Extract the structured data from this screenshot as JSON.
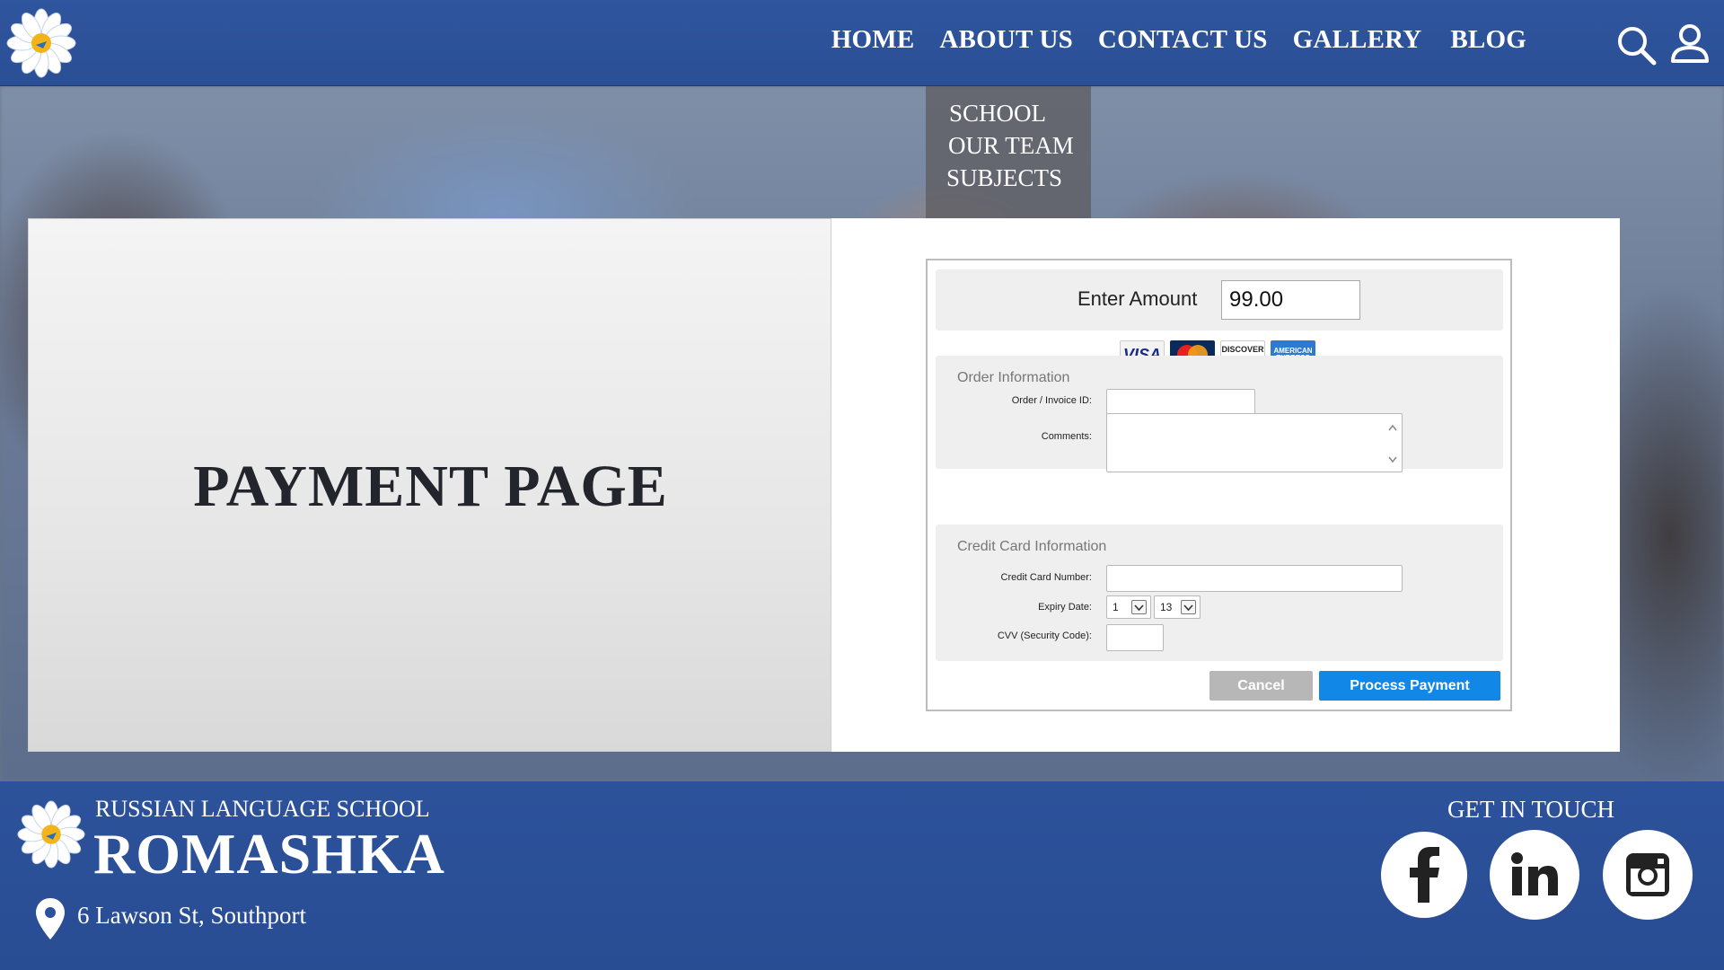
{
  "header": {
    "nav": [
      "HOME",
      "ABOUT US",
      "CONTACT US",
      "GALLERY",
      "BLOG"
    ],
    "icons": {
      "logo": "daisy-logo",
      "search": "search-icon",
      "user": "user-icon"
    }
  },
  "dropdown": {
    "items": [
      "SCHOOL",
      "OUR TEAM",
      "SUBJECTS"
    ]
  },
  "main": {
    "title": "PAYMENT PAGE"
  },
  "payment": {
    "amount_label": "Enter Amount",
    "amount_value": "99.00",
    "card_brands": [
      "VISA",
      "MasterCard",
      "DISCOVER",
      "AMERICAN EXPRESS"
    ],
    "order_section": {
      "title": "Order Information",
      "order_id_label": "Order / Invoice ID:",
      "order_id_value": "",
      "comments_label": "Comments:",
      "comments_value": ""
    },
    "card_section": {
      "title": "Credit Card Information",
      "card_number_label": "Credit Card Number:",
      "card_number_value": "",
      "expiry_label": "Expiry Date:",
      "expiry_month": "1",
      "expiry_year": "13",
      "cvv_label": "CVV (Security Code):",
      "cvv_value": ""
    },
    "cancel_label": "Cancel",
    "process_label": "Process Payment"
  },
  "footer": {
    "school_sub": "RUSSIAN LANGUAGE SCHOOL",
    "school_name": "ROMASHKA",
    "address": "6 Lawson St, Southport",
    "touch_title": "GET IN TOUCH",
    "social": [
      "facebook-icon",
      "linkedin-icon",
      "instagram-icon"
    ]
  },
  "colors": {
    "header_bg": "#2f559e",
    "footer_bg": "#2c529b",
    "process_button": "#1188e8",
    "cancel_button": "#b7b7b7"
  }
}
